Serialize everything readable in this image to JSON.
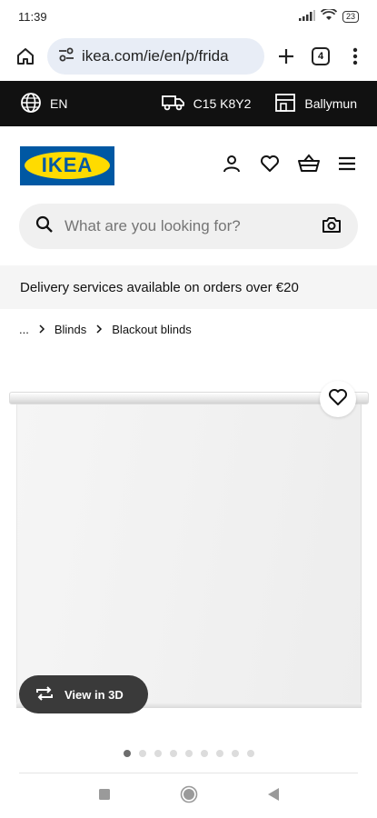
{
  "status_bar": {
    "time": "11:39",
    "battery": "23"
  },
  "browser": {
    "url": "ikea.com/ie/en/p/frida",
    "tab_count": "4"
  },
  "topbar": {
    "language": "EN",
    "postcode": "C15 K8Y2",
    "store": "Ballymun"
  },
  "header": {
    "logo_text": "IKEA"
  },
  "search": {
    "placeholder": "What are you looking for?"
  },
  "delivery": {
    "text": "Delivery services available on orders over €20"
  },
  "breadcrumb": {
    "ellipsis": "...",
    "items": [
      "Blinds",
      "Blackout blinds"
    ]
  },
  "product": {
    "view3d_label": "View in 3D",
    "image_count": 9,
    "active_image": 0
  },
  "colors": {
    "brand_blue": "#0058a3",
    "brand_yellow": "#ffdb00",
    "topbar_bg": "#111111"
  }
}
